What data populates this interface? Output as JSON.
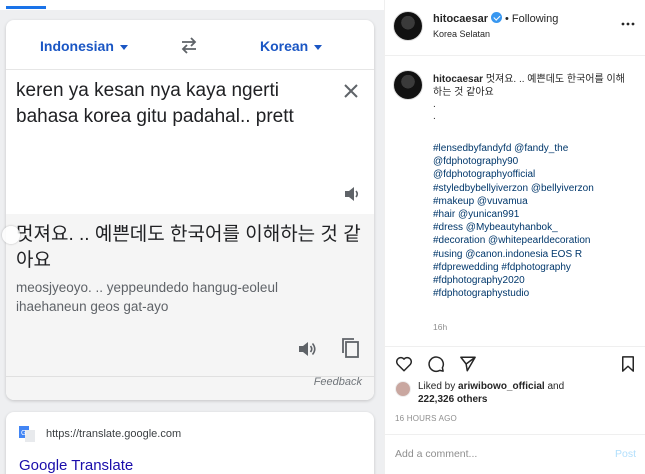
{
  "photo": {
    "translate_card": {
      "source_lang": "Indonesian",
      "target_lang": "Korean",
      "source_text": "keren ya kesan nya kaya ngerti bahasa korea gitu padahal.. prett",
      "result_text": "멋져요. .. 예쁜데도 한국어를 이해하는 것 같아요",
      "romanization": "meosjyeoyo. .. yeppeundedo hangug-eoleul ihaehaneun geos gat-ayo",
      "feedback_label": "Feedback"
    },
    "search_result": {
      "url": "https://translate.google.com",
      "title": "Google Translate"
    }
  },
  "post": {
    "header": {
      "username": "hitocaesar",
      "separator": "•",
      "follow_status": "Following",
      "location": "Korea Selatan"
    },
    "caption": {
      "username": "hitocaesar",
      "text": "멋져요. .. 예쁜데도 한국어를 이해하는 것 같아요",
      "dots": [
        ".",
        "."
      ],
      "tags": [
        "#lensedbyfandyfd @fandy_the",
        "@fdphotography90",
        "@fdphotographyofficial",
        "#styledbybellyiverzon @bellyiverzon",
        "#makeup @vuvamua",
        "#hair @yunican991",
        "#dress @Mybeautyhanbok_",
        "#decoration @whitepearldecoration",
        "#using @canon.indonesia EOS R",
        "#fdprewedding #fdphotography",
        "#fdphotography2020",
        "#fdphotographystudio"
      ],
      "age": "16h"
    },
    "likes": {
      "liked_by_prefix": "Liked by",
      "liked_by_user": "ariwibowo_official",
      "and": "and",
      "others": "222,326 others"
    },
    "time_ago": "16 HOURS AGO",
    "comment": {
      "placeholder": "Add a comment...",
      "post_label": "Post"
    }
  },
  "colors": {
    "google_blue": "#1a56c4",
    "link_blue": "#00376b",
    "verified_blue": "#3897f0",
    "post_disabled": "#b2dffc"
  }
}
